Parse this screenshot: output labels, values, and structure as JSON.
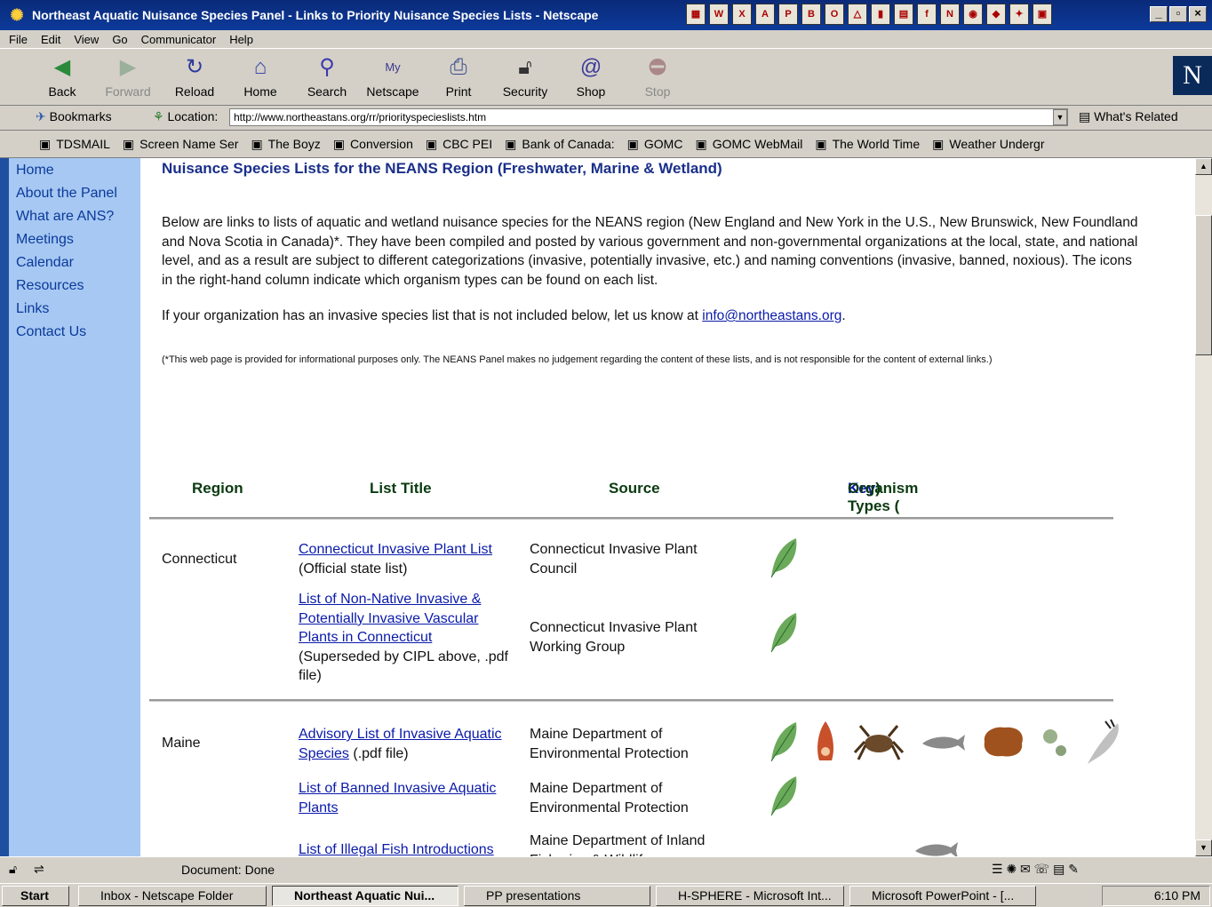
{
  "window": {
    "title": "Northeast Aquatic Nuisance Species Panel - Links to Priority Nuisance Species Lists - Netscape"
  },
  "menu": [
    "File",
    "Edit",
    "View",
    "Go",
    "Communicator",
    "Help"
  ],
  "toolbar": {
    "buttons": [
      {
        "label": "Back",
        "icon": "back-arrow-icon",
        "enabled": true
      },
      {
        "label": "Forward",
        "icon": "forward-arrow-icon",
        "enabled": false
      },
      {
        "label": "Reload",
        "icon": "reload-icon",
        "enabled": true
      },
      {
        "label": "Home",
        "icon": "home-icon",
        "enabled": true
      },
      {
        "label": "Search",
        "icon": "search-icon",
        "enabled": true
      },
      {
        "label": "Netscape",
        "icon": "my-netscape-icon",
        "enabled": true
      },
      {
        "label": "Print",
        "icon": "print-icon",
        "enabled": true
      },
      {
        "label": "Security",
        "icon": "lock-icon",
        "enabled": true
      },
      {
        "label": "Shop",
        "icon": "shop-icon",
        "enabled": true
      },
      {
        "label": "Stop",
        "icon": "stop-icon",
        "enabled": false
      }
    ]
  },
  "location": {
    "bookmarks_label": "Bookmarks",
    "label": "Location:",
    "url": "http://www.northeastans.org/rr/priorityspecieslists.htm",
    "related_label": "What's Related"
  },
  "personal_toolbar": [
    "TDSMAIL",
    "Screen Name Ser",
    "The Boyz",
    "Conversion",
    "CBC PEI",
    "Bank of Canada:",
    "GOMC",
    "GOMC WebMail",
    "The World Time",
    "Weather Undergr"
  ],
  "sidebar": [
    "Home",
    "About the Panel",
    "What are ANS?",
    "Meetings",
    "Calendar",
    "Resources",
    "Links",
    "Contact Us"
  ],
  "page": {
    "heading": "Nuisance Species Lists for the NEANS Region (Freshwater, Marine & Wetland)",
    "intro": "Below are links to lists of aquatic and wetland nuisance species for the NEANS region (New England and New York in the U.S., New Brunswick, New Foundland and Nova Scotia in Canada)*. They have been compiled and posted by various government and non-governmental organizations at the local, state, and national level, and as a result are subject to different categorizations (invasive, potentially invasive, etc.) and naming conventions (invasive, banned, noxious). The icons in the right-hand column indicate which organism types can be found on each list.",
    "contact_prefix": "If your organization has an invasive species list that is not included below, let us know at ",
    "contact_email": "info@northeastans.org",
    "contact_suffix": ".",
    "note": "(*This web page is provided for informational purposes only. The NEANS Panel makes no judgement regarding the content of these lists, and is not responsible for the content of external links.)"
  },
  "table": {
    "headers": {
      "region": "Region",
      "title": "List Title",
      "source": "Source",
      "organisms": "Organism Types (",
      "key": "Key",
      "organisms_end": ")"
    },
    "rows": [
      {
        "region": "Connecticut",
        "link": "Connecticut Invasive Plant List",
        "note": "(Official state list)",
        "source": "Connecticut Invasive Plant Council",
        "organisms": [
          "plant"
        ]
      },
      {
        "region": "",
        "link": "List of Non-Native Invasive & Potentially Invasive Vascular Plants in Connecticut",
        "note": "(Superseded by CIPL above, .pdf file)",
        "source": "Connecticut Invasive Plant Working Group",
        "organisms": [
          "plant"
        ]
      },
      {
        "region": "Maine",
        "link": "Advisory List of Invasive Aquatic Species",
        "note": "(.pdf file)",
        "source": "Maine Department of Environmental Protection",
        "organisms": [
          "plant",
          "snail",
          "crab",
          "fish",
          "algae",
          "pathogen",
          "feather"
        ]
      },
      {
        "region": "",
        "link": "List of Banned Invasive Aquatic Plants",
        "note": "",
        "source": "Maine Department of Environmental Protection",
        "organisms": [
          "plant"
        ]
      },
      {
        "region": "",
        "link": "List of Illegal Fish Introductions",
        "note": "",
        "source": "Maine Department of Inland Fisheries & Wildlife",
        "organisms": [
          "fish"
        ]
      }
    ]
  },
  "status": {
    "text": "Document: Done"
  },
  "taskbar": {
    "start": "Start",
    "tasks": [
      "Inbox - Netscape Folder",
      "Northeast Aquatic Nui...",
      "PP presentations",
      "H-SPHERE - Microsoft Int...",
      "Microsoft PowerPoint - [..."
    ],
    "clock": "6:10 PM"
  }
}
